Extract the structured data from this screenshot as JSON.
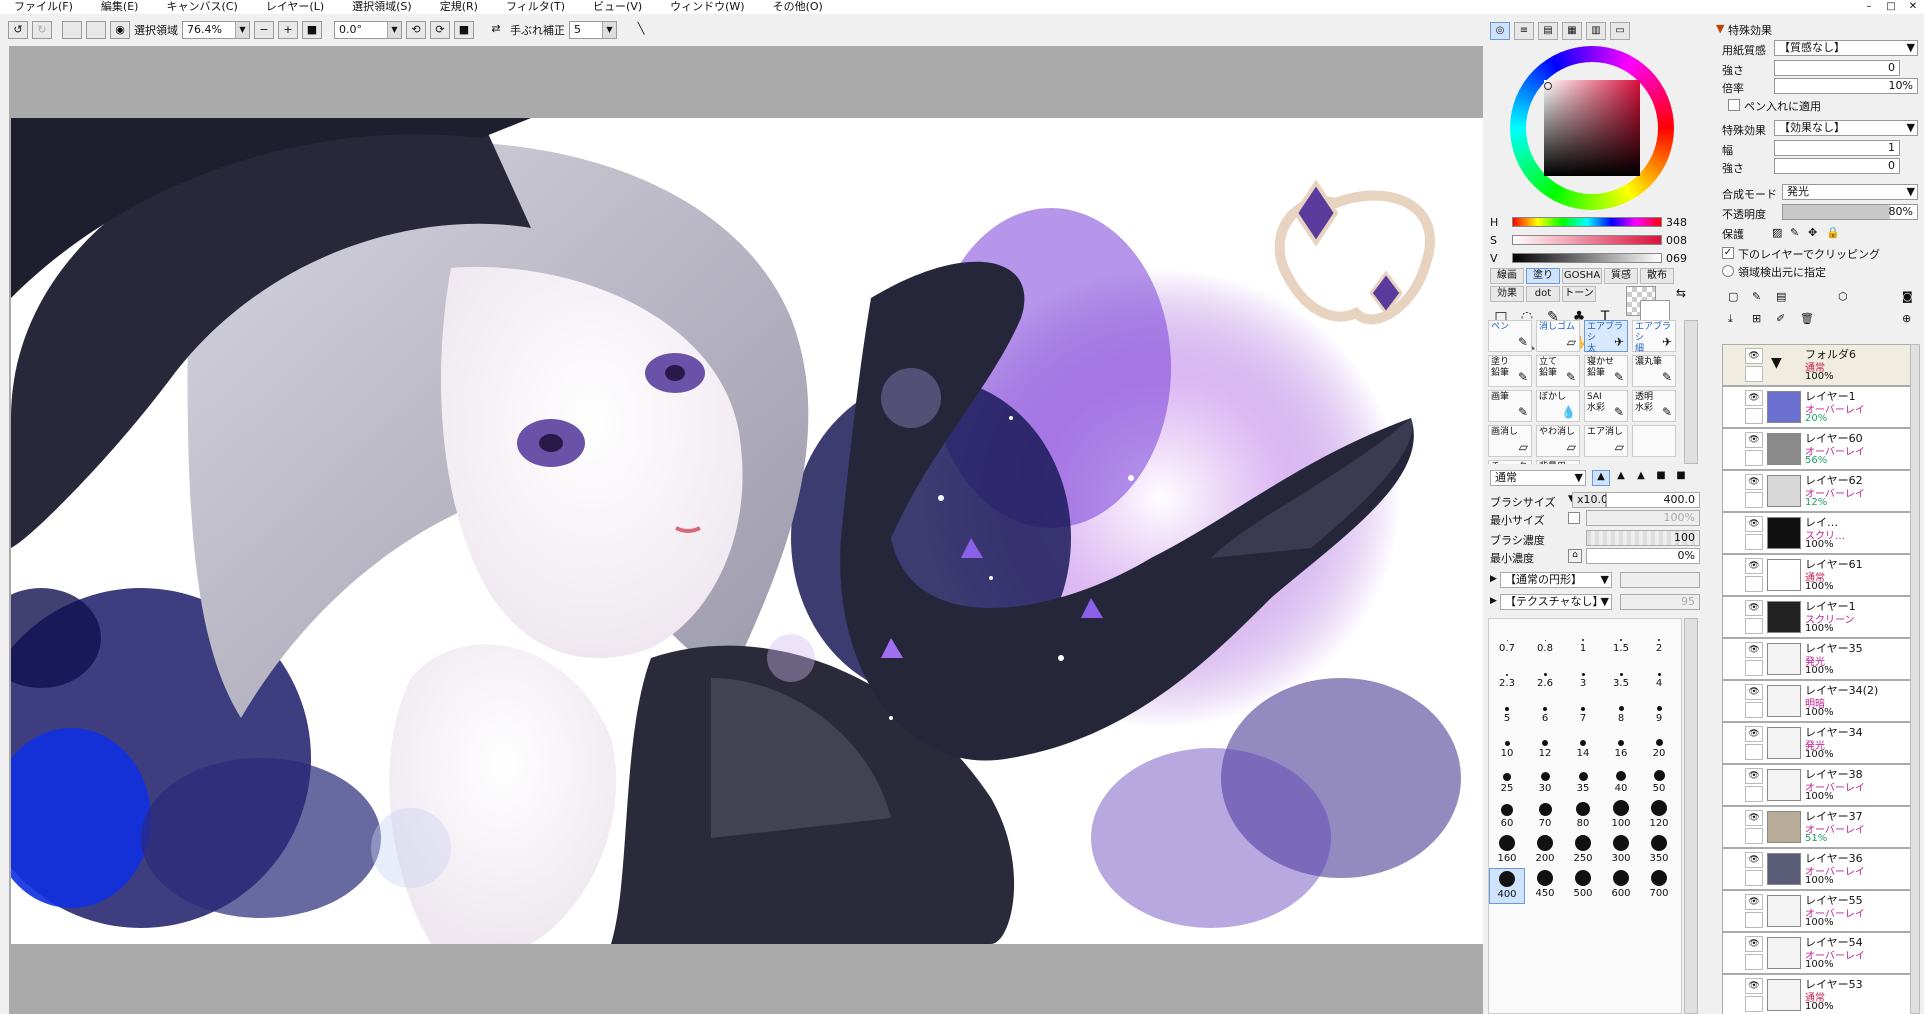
{
  "menu": [
    "ファイル(F)",
    "編集(E)",
    "キャンバス(C)",
    "レイヤー(L)",
    "選択領域(S)",
    "定規(R)",
    "フィルタ(T)",
    "ビュー(V)",
    "ウィンドウ(W)",
    "その他(O)"
  ],
  "window_controls": [
    "–",
    "□",
    "✕"
  ],
  "toolbar": {
    "select_label": "選択領域",
    "zoom": "76.4%",
    "rotation": "0.0°",
    "stabilizer_label": "手ぶれ補正",
    "stabilizer_value": "5"
  },
  "color": {
    "h_label": "H",
    "h_value": "348",
    "s_label": "S",
    "s_value": "008",
    "v_label": "V",
    "v_value": "069",
    "selected": "#b51a37"
  },
  "tool_sets": [
    "線画",
    "塗り",
    "GOSHA",
    "質感",
    "散布",
    "効果",
    "dot",
    "トーン"
  ],
  "tool_icons": [
    "□",
    "◌",
    "✎",
    "♣",
    "T",
    "✥",
    "🔍",
    "↻",
    "✋",
    "⁄"
  ],
  "brushes": [
    {
      "l1": "ペン",
      "l2": "",
      "i": "✎"
    },
    {
      "l1": "消しゴム",
      "l2": "",
      "i": "▱"
    },
    {
      "l1": "エアブラシ",
      "l2": "太",
      "i": "✈"
    },
    {
      "l1": "エアブラシ",
      "l2": "細",
      "i": "✈"
    },
    {
      "l1": "塗り",
      "l2": "鉛筆",
      "i": "✎"
    },
    {
      "l1": "立て",
      "l2": "鉛筆",
      "i": "✎"
    },
    {
      "l1": "寝かせ",
      "l2": "鉛筆",
      "i": "✎"
    },
    {
      "l1": "濃丸筆",
      "l2": "",
      "i": "✎"
    },
    {
      "l1": "画筆",
      "l2": "",
      "i": "✎"
    },
    {
      "l1": "ぼかし",
      "l2": "",
      "i": "💧"
    },
    {
      "l1": "SAI",
      "l2": "水彩",
      "i": "✎"
    },
    {
      "l1": "透明",
      "l2": "水彩",
      "i": "✎"
    },
    {
      "l1": "画消し",
      "l2": "",
      "i": "▱"
    },
    {
      "l1": "やわ消し",
      "l2": "",
      "i": "▱"
    },
    {
      "l1": "エア消し",
      "l2": "",
      "i": "▱"
    },
    {
      "l1": "",
      "l2": "",
      "i": ""
    },
    {
      "l1": "チョーク",
      "l2": "",
      "i": "✎"
    },
    {
      "l1": "背景用",
      "l2": "水彩",
      "i": "✎"
    }
  ],
  "brush_props": {
    "blend": "通常",
    "size_label": "ブラシサイズ",
    "size_mult": "x10.0",
    "size_value": "400.0",
    "min_size_label": "最小サイズ",
    "min_size_value": "100%",
    "density_label": "ブラシ濃度",
    "density_value": "100",
    "min_density_label": "最小濃度",
    "min_density_value": "0%",
    "shape": "【通常の円形】",
    "texture": "【テクスチャなし】",
    "texture_value": "95"
  },
  "dot_sizes": [
    "0.7",
    "0.8",
    "1",
    "1.5",
    "2",
    "2.3",
    "2.6",
    "3",
    "3.5",
    "4",
    "5",
    "6",
    "7",
    "8",
    "9",
    "10",
    "12",
    "14",
    "16",
    "20",
    "25",
    "30",
    "35",
    "40",
    "50",
    "60",
    "70",
    "80",
    "100",
    "120",
    "160",
    "200",
    "250",
    "300",
    "350",
    "400",
    "450",
    "500",
    "600",
    "700"
  ],
  "effects": {
    "header": "特殊効果",
    "paper_label": "用紙質感",
    "paper_value": "【質感なし】",
    "strength_label": "強さ",
    "strength_value": "0",
    "scale_label": "倍率",
    "scale_value": "10%",
    "pen_apply": "ペン入れに適用",
    "effect_label": "特殊効果",
    "effect_value": "【効果なし】",
    "width_label": "幅",
    "width_value": "1",
    "strength2_label": "強さ",
    "strength2_value": "0",
    "blend_label": "合成モード",
    "blend_value": "発光",
    "opacity_label": "不透明度",
    "opacity_value": "80%",
    "protect_label": "保護",
    "clip_label": "下のレイヤーでクリッピング",
    "detect_label": "領域検出元に指定"
  },
  "layers": [
    {
      "name": "フォルダ6",
      "mode": "通常",
      "opacity": "100%",
      "thumb": "#ffffff",
      "folder": true
    },
    {
      "name": "レイヤー1",
      "mode": "オーバーレイ",
      "opacity": "20%",
      "thumb": "#6a6fd0"
    },
    {
      "name": "レイヤー60",
      "mode": "オーバーレイ",
      "opacity": "56%",
      "thumb": "#8a8a8a"
    },
    {
      "name": "レイヤー62",
      "mode": "オーバーレイ",
      "opacity": "12%",
      "thumb": "#d8d8d8"
    },
    {
      "name": "レイ…",
      "mode": "スクリ…",
      "opacity": "100%",
      "thumb": "#111111"
    },
    {
      "name": "レイヤー61",
      "mode": "通常",
      "opacity": "100%",
      "thumb": "#ffffff"
    },
    {
      "name": "レイヤー1",
      "mode": "スクリーン",
      "opacity": "100%",
      "thumb": "#222222"
    },
    {
      "name": "レイヤー35",
      "mode": "発光",
      "opacity": "100%",
      "thumb": "#f4f4f4"
    },
    {
      "name": "レイヤー34(2)",
      "mode": "明暗",
      "opacity": "100%",
      "thumb": "#f4f4f4"
    },
    {
      "name": "レイヤー34",
      "mode": "発光",
      "opacity": "100%",
      "thumb": "#f4f4f4"
    },
    {
      "name": "レイヤー38",
      "mode": "オーバーレイ",
      "opacity": "100%",
      "thumb": "#f4f4f4"
    },
    {
      "name": "レイヤー37",
      "mode": "オーバーレイ",
      "opacity": "51%",
      "thumb": "#b8ab98"
    },
    {
      "name": "レイヤー36",
      "mode": "オーバーレイ",
      "opacity": "100%",
      "thumb": "#5a5c78"
    },
    {
      "name": "レイヤー55",
      "mode": "オーバーレイ",
      "opacity": "100%",
      "thumb": "#f4f4f4"
    },
    {
      "name": "レイヤー54",
      "mode": "オーバーレイ",
      "opacity": "100%",
      "thumb": "#f4f4f4"
    },
    {
      "name": "レイヤー53",
      "mode": "通常",
      "opacity": "100%",
      "thumb": "#f4f4f4"
    }
  ]
}
